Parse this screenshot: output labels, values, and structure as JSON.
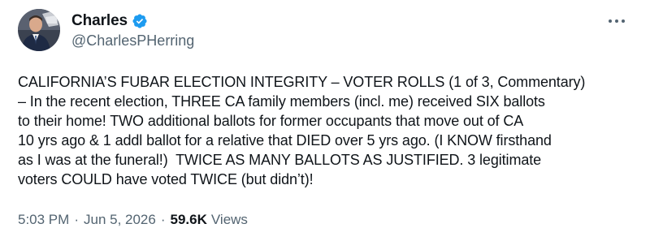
{
  "author": {
    "display_name": "Charles",
    "handle": "@CharlesPHerring",
    "verified_icon": "verified-badge-icon",
    "verified_color": "#1d9bf0"
  },
  "more_icon": "more-horizontal-icon",
  "tweet": {
    "lines": [
      "CALIFORNIA’S FUBAR ELECTION INTEGRITY – VOTER ROLLS (1 of 3, Commentary)",
      "– In the recent election, THREE CA family members (incl. me) received SIX ballots",
      "to their home! TWO additional ballots for former occupants that move out of CA",
      "10 yrs ago & 1 addl ballot for a relative that DIED over 5 yrs ago. (I KNOW firsthand",
      "as I was at the funeral!)  TWICE AS MANY BALLOTS AS JUSTIFIED. 3 legitimate",
      "voters COULD have voted TWICE (but didn’t)!"
    ]
  },
  "meta": {
    "time": "5:03 PM",
    "separator": "·",
    "date": "Jun 5, 2026",
    "views_count": "59.6K",
    "views_label": "Views"
  },
  "colors": {
    "text": "#0f1419",
    "secondary": "#536471",
    "accent": "#1d9bf0"
  }
}
